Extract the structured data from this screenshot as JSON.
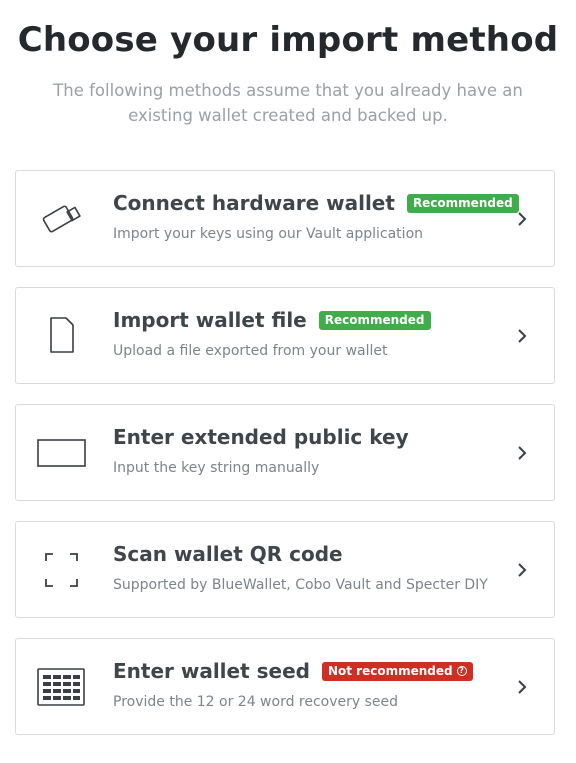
{
  "header": {
    "title": "Choose your import method",
    "subtitle": "The following methods assume that you already have an existing wallet created and backed up."
  },
  "options": [
    {
      "name": "Connect hardware wallet",
      "badge": "Recommended",
      "badge_color": "#3fad4a",
      "description": "Import your keys using our Vault application",
      "icon": "usb-stick-icon"
    },
    {
      "name": "Import wallet file",
      "badge": "Recommended",
      "badge_color": "#3fad4a",
      "description": "Upload a file exported from your wallet",
      "icon": "file-icon"
    },
    {
      "name": "Enter extended public key",
      "badge": "",
      "description": "Input the key string manually",
      "icon": "text-field-icon"
    },
    {
      "name": "Scan wallet QR code",
      "badge": "",
      "description": "Supported by BlueWallet, Cobo Vault and Specter DIY",
      "icon": "qr-scan-icon"
    },
    {
      "name": "Enter wallet seed",
      "badge": "Not recommended",
      "badge_color": "#cf2f23",
      "description": "Provide the 12 or 24 word recovery seed",
      "icon": "keyboard-icon"
    }
  ],
  "colors": {
    "recommended": "#3fad4a",
    "not_recommended": "#cf2f23",
    "border": "#d9dcdf"
  }
}
